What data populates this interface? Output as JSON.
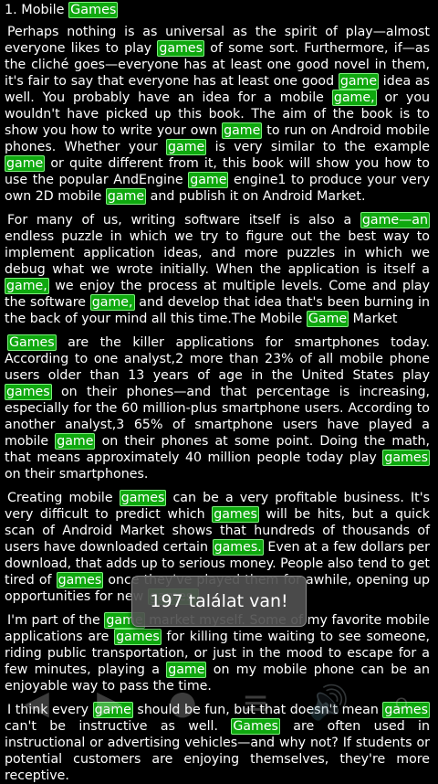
{
  "chapter_title_parts": [
    {
      "t": "1. Mobile ",
      "h": false
    },
    {
      "t": "Games",
      "h": true
    }
  ],
  "paragraphs": [
    [
      {
        "t": "Perhaps nothing is as universal as the spirit of play—almost everyone likes to play ",
        "h": false
      },
      {
        "t": "games",
        "h": true
      },
      {
        "t": " of some sort. Furthermore, if—as the cliché goes—everyone has at least one good novel in them, it's fair to say that everyone has at least one good ",
        "h": false
      },
      {
        "t": "game",
        "h": true
      },
      {
        "t": " idea as well. You probably have an idea for a mobile ",
        "h": false
      },
      {
        "t": "game,",
        "h": true
      },
      {
        "t": " or you wouldn't have picked up this book. The aim of the book is to show you how to write your own ",
        "h": false
      },
      {
        "t": "game",
        "h": true
      },
      {
        "t": " to run on Android mobile phones. Whether your ",
        "h": false
      },
      {
        "t": "game",
        "h": true
      },
      {
        "t": " is very similar to the example ",
        "h": false
      },
      {
        "t": "game",
        "h": true
      },
      {
        "t": " or quite different from it, this book will show you how to use the popular AndEngine ",
        "h": false
      },
      {
        "t": "game",
        "h": true
      },
      {
        "t": " engine1 to produce your very own 2D mobile ",
        "h": false
      },
      {
        "t": "game",
        "h": true
      },
      {
        "t": " and publish it on Android Market.",
        "h": false
      }
    ],
    [
      {
        "t": "For many of us, writing software itself is also a ",
        "h": false
      },
      {
        "t": "game—an",
        "h": true
      },
      {
        "t": " endless puzzle in which we try to figure out the best way to implement application ideas, and more puzzles in which we debug what we wrote initially. When the application is itself a ",
        "h": false
      },
      {
        "t": "game,",
        "h": true
      },
      {
        "t": " we enjoy the process at multiple levels. Come and play the software ",
        "h": false
      },
      {
        "t": "game,",
        "h": true
      },
      {
        "t": " and develop that idea that's been burning in the back of your mind all this time.The Mobile ",
        "h": false
      },
      {
        "t": "Game",
        "h": true
      },
      {
        "t": " Market",
        "h": false
      }
    ],
    [
      {
        "t": "Games",
        "h": true
      },
      {
        "t": " are the killer applications for smartphones today. According to one analyst,2 more than 23% of all mobile phone users older than 13 years of age in the United States play ",
        "h": false
      },
      {
        "t": "games",
        "h": true
      },
      {
        "t": " on their phones—and that percentage is increasing, especially for the 60 million-plus smartphone users. According to another analyst,3 65% of smartphone users have played a mobile ",
        "h": false
      },
      {
        "t": "game",
        "h": true
      },
      {
        "t": " on their phones at some point. Doing the math, that means approximately 40 million people today play ",
        "h": false
      },
      {
        "t": "games",
        "h": true
      },
      {
        "t": " on their smartphones.",
        "h": false
      }
    ],
    [
      {
        "t": "Creating mobile ",
        "h": false
      },
      {
        "t": "games",
        "h": true
      },
      {
        "t": " can be a very profitable business. It's very difficult to predict which ",
        "h": false
      },
      {
        "t": "games",
        "h": true
      },
      {
        "t": " will be hits, but a quick scan of Android Market shows that hundreds of thousands of users have downloaded certain ",
        "h": false
      },
      {
        "t": "games.",
        "h": true
      },
      {
        "t": " Even at a few dollars per download, that adds up to serious money. People also tend to get tired of ",
        "h": false
      },
      {
        "t": "games",
        "h": true
      },
      {
        "t": " once they've played them for awhile, opening up opportunities for new ",
        "h": false
      },
      {
        "t": "games.",
        "h": true
      }
    ],
    [
      {
        "t": "I'm part of the ",
        "h": false
      },
      {
        "t": "game",
        "h": true
      },
      {
        "t": " market myself. Some of my favorite mobile applications are ",
        "h": false
      },
      {
        "t": "games",
        "h": true
      },
      {
        "t": " for killing time waiting to see someone, riding public transportation, or just in the mood to escape for a few minutes, playing a ",
        "h": false
      },
      {
        "t": "game",
        "h": true
      },
      {
        "t": " on my mobile phone can be an enjoyable way to pass the time.",
        "h": false
      }
    ],
    [
      {
        "t": "I think every ",
        "h": false
      },
      {
        "t": "game",
        "h": true
      },
      {
        "t": " should be fun, but that doesn't mean ",
        "h": false
      },
      {
        "t": "games",
        "h": true
      },
      {
        "t": " can't be instructive as well. ",
        "h": false
      },
      {
        "t": "Games",
        "h": true
      },
      {
        "t": " are often used in instructional or advertising vehicles—and why not? If students or potential customers are enjoying themselves, they're more receptive.",
        "h": false
      }
    ]
  ],
  "toast": {
    "text": "197 találat van!"
  },
  "toolbar": {
    "icons": [
      {
        "name": "back-arrow-icon",
        "glyph": "◀"
      },
      {
        "name": "forward-arrow-icon",
        "glyph": "▶"
      },
      {
        "name": "circle-icon",
        "glyph": "●"
      },
      {
        "name": "menu-icon",
        "glyph": "≡"
      },
      {
        "name": "volume-icon",
        "glyph": "🔊"
      },
      {
        "name": "search-icon",
        "glyph": "⌕"
      }
    ]
  },
  "colors": {
    "highlight_bg": "#0fa80f",
    "highlight_border": "#7bf07b",
    "page_bg": "#000000",
    "text": "#ffffff"
  }
}
